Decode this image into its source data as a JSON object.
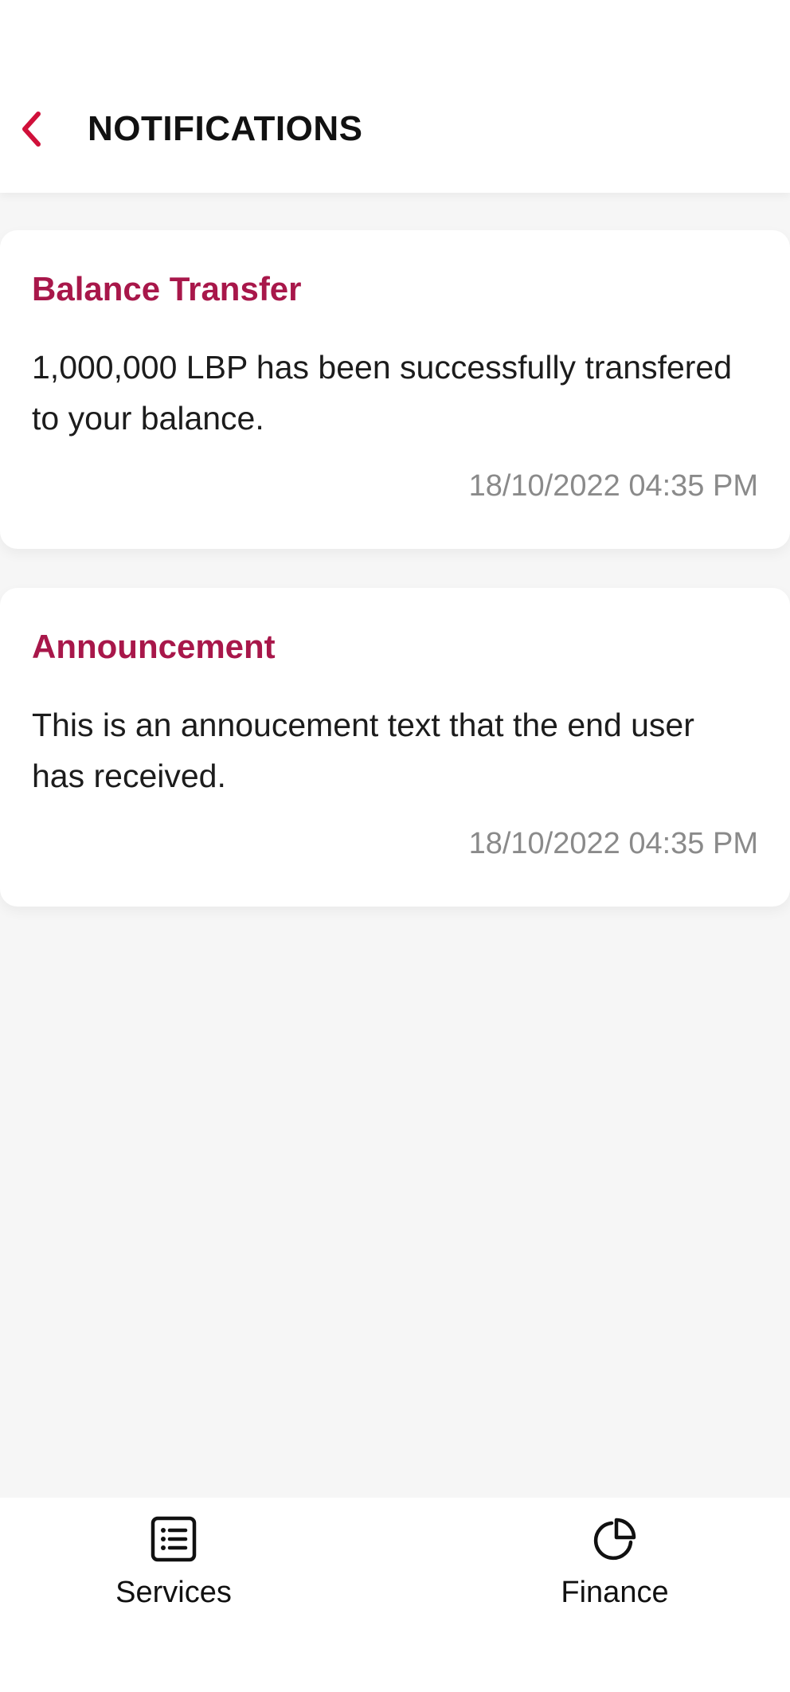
{
  "header": {
    "title": "NOTIFICATIONS",
    "back_icon": "chevron-left-icon"
  },
  "notifications": [
    {
      "title": "Balance Transfer",
      "body": "1,000,000 LBP has been successfully transfered to your balance.",
      "timestamp": "18/10/2022 04:35 PM"
    },
    {
      "title": "Announcement",
      "body": "This is an annoucement text that the end user has received.",
      "timestamp": "18/10/2022 04:35 PM"
    }
  ],
  "bottom_nav": [
    {
      "label": "Services",
      "icon": "list-icon"
    },
    {
      "label": "Finance",
      "icon": "pie-chart-icon"
    }
  ],
  "colors": {
    "accent": "#a8174a",
    "back_icon": "#d0103a",
    "background": "#f6f6f6",
    "card": "#ffffff",
    "timestamp": "#8a8a8a"
  }
}
